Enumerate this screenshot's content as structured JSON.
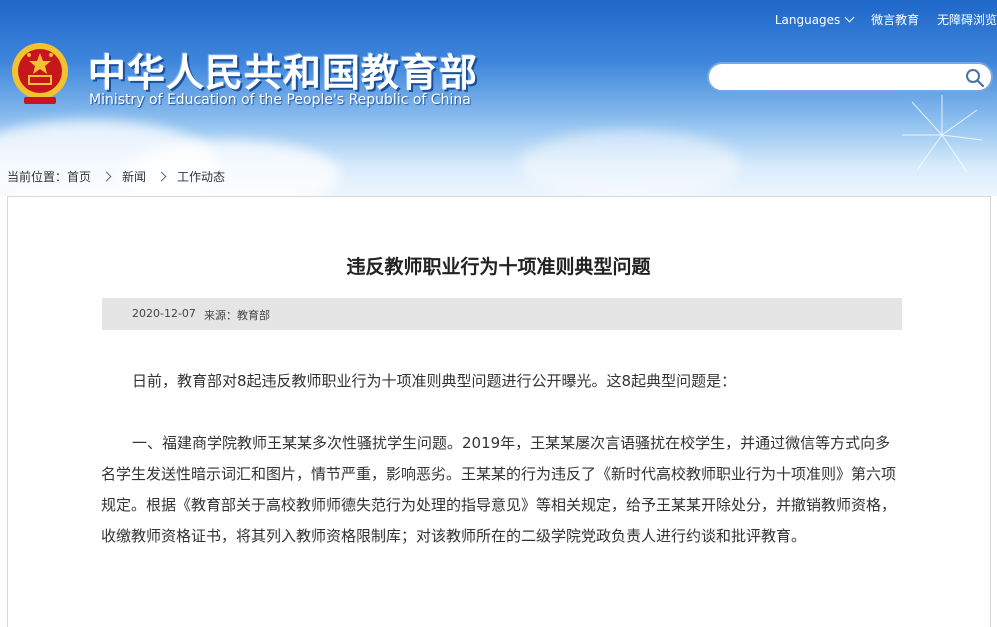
{
  "header": {
    "site_title": "中华人民共和国教育部",
    "site_subtitle": "Ministry of Education of the People's Republic of China",
    "links": {
      "languages": "Languages",
      "weibo": "微言教育",
      "accessibility": "无障碍浏览"
    },
    "search": {
      "placeholder": "",
      "value": ""
    }
  },
  "breadcrumb": {
    "prefix": "当前位置：",
    "items": [
      "首页",
      "新闻",
      "工作动态"
    ]
  },
  "article": {
    "title": "违反教师职业行为十项准则典型问题",
    "date": "2020-12-07",
    "source": "来源：教育部",
    "paragraphs": [
      "日前，教育部对8起违反教师职业行为十项准则典型问题进行公开曝光。这8起典型问题是：",
      "一、福建商学院教师王某某多次性骚扰学生问题。2019年，王某某屡次言语骚扰在校学生，并通过微信等方式向多名学生发送性暗示词汇和图片，情节严重，影响恶劣。王某某的行为违反了《新时代高校教师职业行为十项准则》第六项规定。根据《教育部关于高校教师师德失范行为处理的指导意见》等相关规定，给予王某某开除处分，并撤销教师资格，收缴教师资格证书，将其列入教师资格限制库；对该教师所在的二级学院党政负责人进行约谈和批评教育。"
    ]
  },
  "colors": {
    "header_top": "#1f67c9",
    "header_bottom": "#eef6fd",
    "meta_bar": "#e5e5e5",
    "emblem_red": "#c8161d",
    "emblem_gold": "#f2c230"
  },
  "icons": [
    "national-emblem-icon",
    "search-icon",
    "chevron-down-icon",
    "chevron-right-icon"
  ]
}
